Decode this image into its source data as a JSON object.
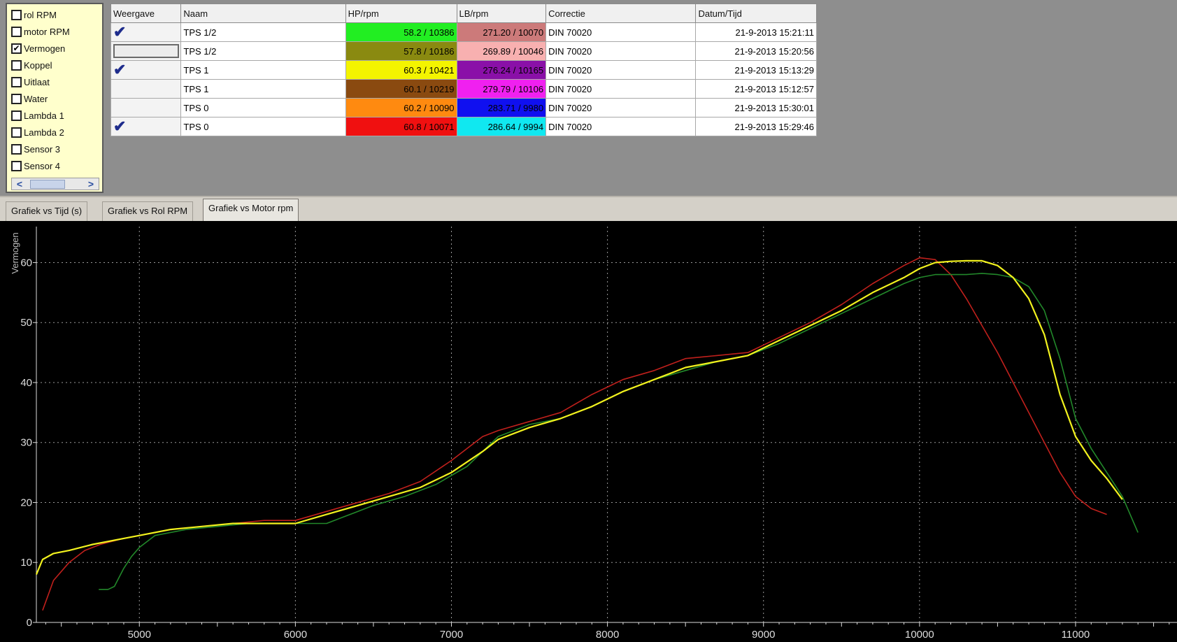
{
  "channels": [
    {
      "label": "rol RPM",
      "checked": false
    },
    {
      "label": "motor RPM",
      "checked": false
    },
    {
      "label": "Vermogen",
      "checked": true
    },
    {
      "label": "Koppel",
      "checked": false
    },
    {
      "label": "Uitlaat",
      "checked": false
    },
    {
      "label": "Water",
      "checked": false
    },
    {
      "label": "Lambda 1",
      "checked": false
    },
    {
      "label": "Lambda 2",
      "checked": false
    },
    {
      "label": "Sensor 3",
      "checked": false
    },
    {
      "label": "Sensor 4",
      "checked": false
    }
  ],
  "scroll": {
    "left": "<",
    "right": ">"
  },
  "table": {
    "headers": [
      "Weergave",
      "Naam",
      "HP/rpm",
      "LB/rpm",
      "Correctie",
      "Datum/Tijd"
    ],
    "rows": [
      {
        "shown": true,
        "naam": "TPS 1/2",
        "hp": "58.2 / 10386",
        "hp_color": "#22ee22",
        "lb": "271.20 / 10070",
        "lb_color": "#cc7a7a",
        "correctie": "DIN 70020",
        "datum": "21-9-2013 15:21:11"
      },
      {
        "shown": false,
        "selected": true,
        "naam": "TPS 1/2",
        "hp": "57.8 / 10186",
        "hp_color": "#8a8a10",
        "lb": "269.89 / 10046",
        "lb_color": "#f8b0b0",
        "correctie": "DIN 70020",
        "datum": "21-9-2013 15:20:56"
      },
      {
        "shown": true,
        "naam": "TPS 1",
        "hp": "60.3 / 10421",
        "hp_color": "#f4f400",
        "lb": "276.24 / 10165",
        "lb_color": "#8a10a8",
        "correctie": "DIN 70020",
        "datum": "21-9-2013 15:13:29"
      },
      {
        "shown": false,
        "naam": "TPS 1",
        "hp": "60.1 / 10219",
        "hp_color": "#8a4a10",
        "lb": "279.79 / 10106",
        "lb_color": "#f020f0",
        "correctie": "DIN 70020",
        "datum": "21-9-2013 15:12:57"
      },
      {
        "shown": false,
        "naam": "TPS 0",
        "hp": "60.2 / 10090",
        "hp_color": "#ff8a10",
        "lb": "283.71 / 9980",
        "lb_color": "#1010f0",
        "correctie": "DIN 70020",
        "datum": "21-9-2013 15:30:01"
      },
      {
        "shown": true,
        "naam": "TPS 0",
        "hp": "60.8 / 10071",
        "hp_color": "#f01010",
        "lb": "286.64 / 9994",
        "lb_color": "#10e8f0",
        "correctie": "DIN 70020",
        "datum": "21-9-2013 15:29:46"
      }
    ]
  },
  "tabs": [
    {
      "label": "Grafiek vs Tijd (s)",
      "active": false
    },
    {
      "label": "Grafiek vs Rol RPM",
      "active": false
    },
    {
      "label": "Grafiek vs Motor rpm",
      "active": true
    }
  ],
  "chart_data": {
    "type": "line",
    "ylabel": "Vermogen",
    "xlabel": "",
    "xlim": [
      4340,
      11650
    ],
    "ylim": [
      0,
      66
    ],
    "xticks": [
      5000,
      6000,
      7000,
      8000,
      9000,
      10000,
      11000
    ],
    "yticks": [
      0,
      10,
      20,
      30,
      40,
      50,
      60
    ],
    "grid": true,
    "series": [
      {
        "color": "#c0201c",
        "x": [
          4380,
          4450,
          4550,
          4650,
          4750,
          4900,
          5000,
          5200,
          5400,
          5600,
          5800,
          6000,
          6200,
          6400,
          6600,
          6800,
          7000,
          7200,
          7300,
          7500,
          7700,
          7900,
          8100,
          8300,
          8500,
          8700,
          8900,
          9100,
          9300,
          9500,
          9700,
          9900,
          10000,
          10100,
          10200,
          10300,
          10400,
          10500,
          10600,
          10700,
          10800,
          10900,
          11000,
          11100,
          11200
        ],
        "y": [
          2,
          7,
          10,
          12,
          13,
          14,
          14.5,
          15.5,
          16,
          16.5,
          17,
          17,
          18.5,
          20,
          21.5,
          23.5,
          27,
          31,
          32,
          33.5,
          35,
          38,
          40.5,
          42,
          44,
          44.5,
          45,
          47.5,
          50,
          53,
          56.5,
          59.5,
          60.8,
          60.5,
          58,
          54,
          49.5,
          45,
          40,
          35,
          30,
          25,
          21,
          19,
          18
        ]
      },
      {
        "color": "#22882a",
        "x": [
          4740,
          4800,
          4840,
          4900,
          4950,
          5000,
          5100,
          5300,
          5500,
          5700,
          5900,
          6100,
          6200,
          6300,
          6500,
          6700,
          6900,
          7100,
          7200,
          7300,
          7500,
          7700,
          7900,
          8100,
          8300,
          8500,
          8700,
          8900,
          9100,
          9300,
          9500,
          9700,
          9900,
          10000,
          10100,
          10200,
          10300,
          10400,
          10500,
          10600,
          10700,
          10800,
          10900,
          11000,
          11100,
          11200,
          11300,
          11400
        ],
        "y": [
          5.5,
          5.5,
          6,
          9,
          11,
          12.5,
          14.5,
          15.5,
          16,
          16.5,
          16.5,
          16.5,
          16.5,
          17.5,
          19.5,
          21,
          23,
          26,
          28.5,
          31,
          33,
          34,
          36,
          38.5,
          40.5,
          42,
          43.5,
          44.5,
          46.5,
          49,
          51.5,
          54,
          56.5,
          57.5,
          58,
          58,
          58,
          58.2,
          58,
          57.5,
          56,
          52,
          44,
          34,
          29,
          25,
          21,
          15
        ]
      },
      {
        "color": "#f2f21e",
        "x": [
          4340,
          4380,
          4450,
          4550,
          4700,
          4900,
          5000,
          5200,
          5400,
          5600,
          5800,
          6000,
          6200,
          6400,
          6600,
          6800,
          7000,
          7200,
          7300,
          7500,
          7700,
          7900,
          8100,
          8300,
          8500,
          8700,
          8900,
          9100,
          9300,
          9500,
          9700,
          9900,
          10000,
          10100,
          10200,
          10300,
          10400,
          10500,
          10600,
          10700,
          10800,
          10900,
          11000,
          11100,
          11200,
          11300
        ],
        "y": [
          8,
          10.5,
          11.5,
          12,
          13,
          14,
          14.5,
          15.5,
          16,
          16.5,
          16.5,
          16.5,
          18,
          19.5,
          21,
          22.5,
          25,
          28.5,
          30.5,
          32.5,
          34,
          36,
          38.5,
          40.5,
          42.5,
          43.5,
          44.5,
          47,
          49.5,
          52,
          55,
          57.5,
          59,
          60,
          60.2,
          60.3,
          60.3,
          59.5,
          57.5,
          54,
          48,
          38,
          31,
          27,
          24,
          20.5
        ]
      }
    ]
  }
}
